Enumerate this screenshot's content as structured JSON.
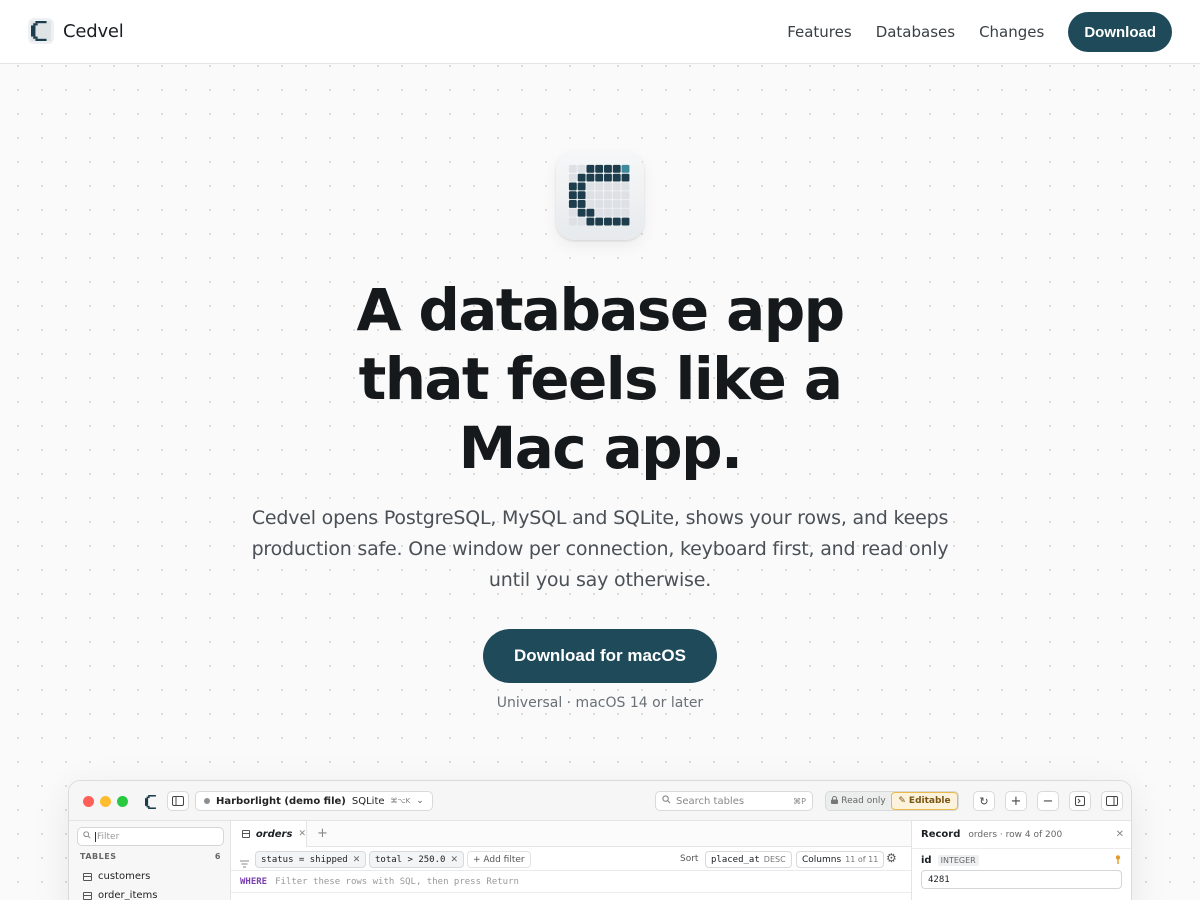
{
  "nav": {
    "brand": "Cedvel",
    "links": [
      "Features",
      "Databases",
      "Changes"
    ],
    "cta": "Download"
  },
  "hero": {
    "title_lines": [
      "A database app",
      "that feels like a",
      "Mac app."
    ],
    "subtitle": "Cedvel opens PostgreSQL, MySQL and SQLite, shows your rows, and keeps production safe. One window per connection, keyboard first, and read only until you say otherwise.",
    "cta": "Download for macOS",
    "meta": "Universal · macOS 14 or later"
  },
  "app": {
    "connection": {
      "name": "Harborlight (demo file)",
      "engine": "SQLite",
      "shortcut": "⌘⌥K"
    },
    "search": {
      "placeholder": "Search tables",
      "shortcut": "⌘P"
    },
    "mode": {
      "read_only": "Read only",
      "editable": "Editable",
      "active": "editable"
    },
    "sidebar": {
      "filter_placeholder": "Filter",
      "section": "TABLES",
      "count": "6",
      "items": [
        "customers",
        "order_items"
      ]
    },
    "tab": {
      "label": "orders"
    },
    "filters": [
      {
        "text": "status = shipped"
      },
      {
        "text": "total > 250.0"
      }
    ],
    "add_filter": "+ Add filter",
    "sort": {
      "label": "Sort",
      "column": "placed_at",
      "direction": "DESC"
    },
    "columns": {
      "label": "Columns",
      "value": "11 of 11"
    },
    "where": {
      "keyword": "WHERE",
      "placeholder": "Filter these rows with SQL, then press Return"
    },
    "record": {
      "title": "Record",
      "meta": "orders · row 4 of 200",
      "field": {
        "name": "id",
        "type": "INTEGER",
        "value": "4281"
      }
    }
  },
  "colors": {
    "accent": "#1f4a5a",
    "editable_border": "#e9b94a",
    "where_keyword": "#7a3fb0"
  }
}
